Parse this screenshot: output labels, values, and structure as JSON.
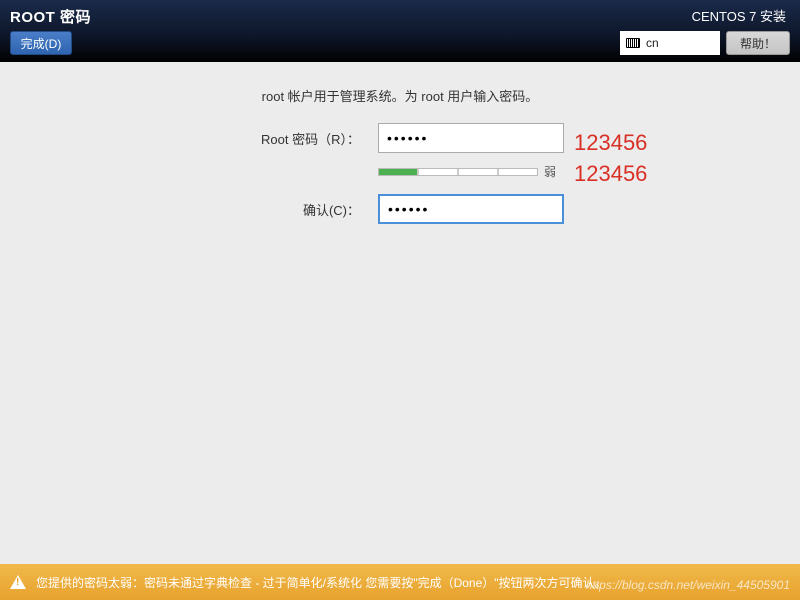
{
  "header": {
    "page_title": "ROOT 密码",
    "done_label": "完成(D)",
    "installer_title": "CENTOS 7 安装",
    "lang_code": "cn",
    "help_label": "帮助！"
  },
  "form": {
    "instruction": "root 帐户用于管理系统。为 root 用户输入密码。",
    "password_label": "Root 密码（R）：",
    "password_value": "••••••",
    "strength_text": "弱",
    "confirm_label": "确认(C)：",
    "confirm_value": "••••••"
  },
  "annotations": {
    "line1": "123456",
    "line2": "123456"
  },
  "warning": {
    "text": "您提供的密码太弱：密码未通过字典检查 - 过于简单化/系统化 您需要按\"完成（Done）\"按钮两次方可确认。"
  },
  "watermark": "https://blog.csdn.net/weixin_44505901"
}
